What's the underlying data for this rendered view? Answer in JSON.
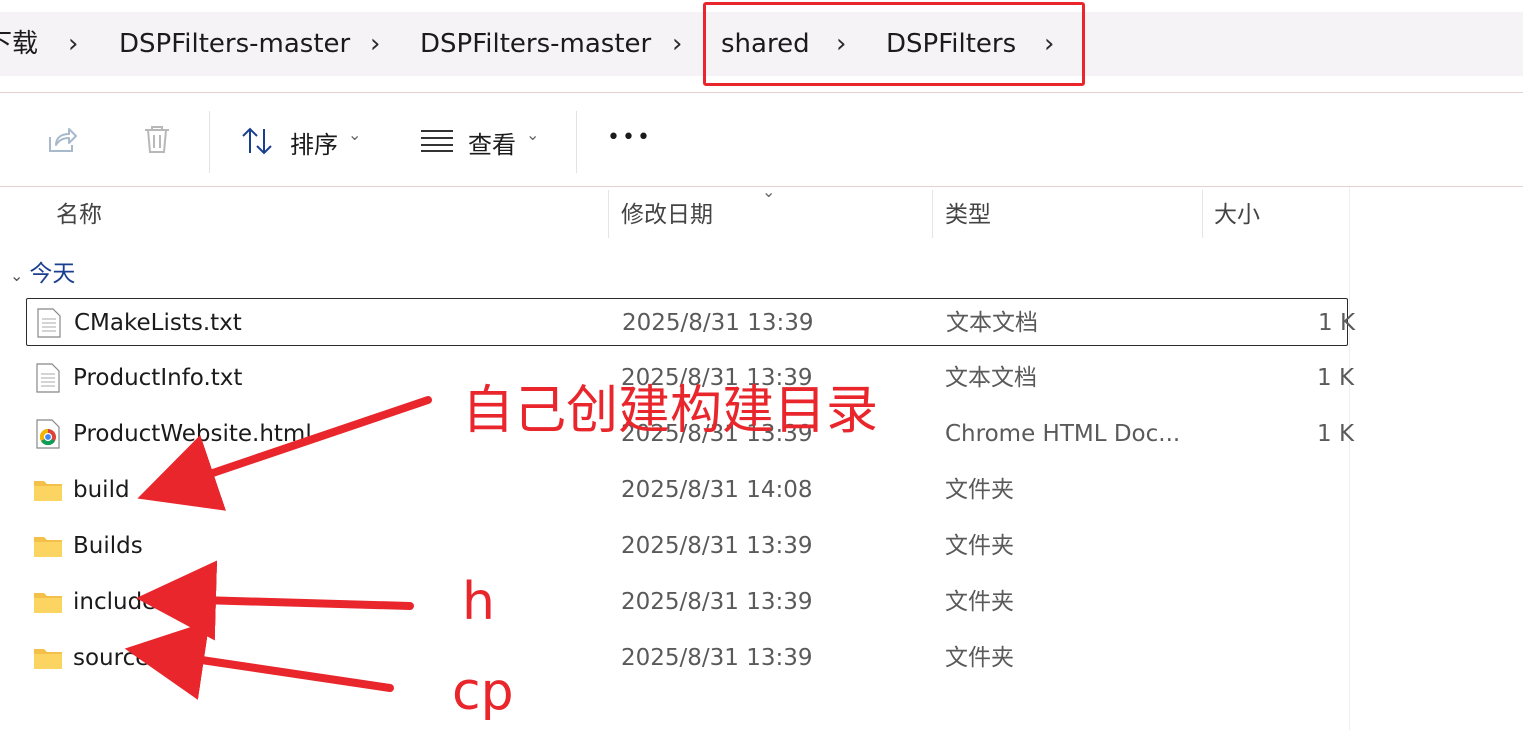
{
  "breadcrumb": {
    "items": [
      "下载",
      "DSPFilters-master",
      "DSPFilters-master",
      "shared",
      "DSPFilters"
    ]
  },
  "toolbar": {
    "sort_label": "排序",
    "view_label": "查看",
    "more_label": "•••"
  },
  "columns": [
    "名称",
    "修改日期",
    "类型",
    "大小"
  ],
  "group_label": "今天",
  "files": [
    {
      "name": "CMakeLists.txt",
      "date": "2025/8/31 13:39",
      "type": "文本文档",
      "size": "1 K",
      "icon": "text-file-icon"
    },
    {
      "name": "ProductInfo.txt",
      "date": "2025/8/31 13:39",
      "type": "文本文档",
      "size": "1 K",
      "icon": "text-file-icon"
    },
    {
      "name": "ProductWebsite.html",
      "date": "2025/8/31 13:39",
      "type": "Chrome HTML Doc...",
      "size": "1 K",
      "icon": "chrome-icon"
    },
    {
      "name": "build",
      "date": "2025/8/31 14:08",
      "type": "文件夹",
      "size": "",
      "icon": "folder-icon"
    },
    {
      "name": "Builds",
      "date": "2025/8/31 13:39",
      "type": "文件夹",
      "size": "",
      "icon": "folder-icon"
    },
    {
      "name": "include",
      "date": "2025/8/31 13:39",
      "type": "文件夹",
      "size": "",
      "icon": "folder-icon"
    },
    {
      "name": "source",
      "date": "2025/8/31 13:39",
      "type": "文件夹",
      "size": "",
      "icon": "folder-icon"
    }
  ],
  "annotations": {
    "main": "自己创建构建目录",
    "h": "h",
    "cp": "cp"
  },
  "colors": {
    "annotation_red": "#e8262c",
    "group_blue": "#1a3f8f"
  }
}
